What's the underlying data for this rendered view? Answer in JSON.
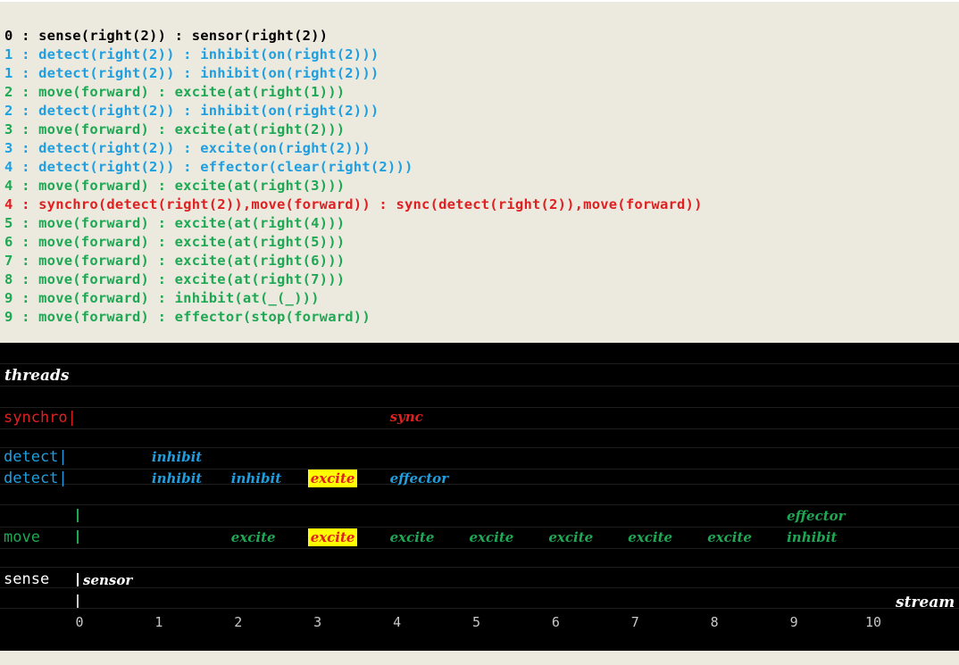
{
  "colors": {
    "log_bg": "#ece9df",
    "panel_bg": "#000000",
    "black": "#000000",
    "blue": "#1f9fe0",
    "green": "#1fa854",
    "red": "#e02020",
    "white": "#ffffff",
    "highlight": "#ffff00",
    "axis": "#c8c8c8"
  },
  "log": [
    {
      "text": "0 : sense(right(2)) : sensor(right(2))",
      "color": "black"
    },
    {
      "text": "1 : detect(right(2)) : inhibit(on(right(2)))",
      "color": "blue"
    },
    {
      "text": "1 : detect(right(2)) : inhibit(on(right(2)))",
      "color": "blue"
    },
    {
      "text": "2 : move(forward) : excite(at(right(1)))",
      "color": "green"
    },
    {
      "text": "2 : detect(right(2)) : inhibit(on(right(2)))",
      "color": "blue"
    },
    {
      "text": "3 : move(forward) : excite(at(right(2)))",
      "color": "green"
    },
    {
      "text": "3 : detect(right(2)) : excite(on(right(2)))",
      "color": "blue"
    },
    {
      "text": "4 : detect(right(2)) : effector(clear(right(2)))",
      "color": "blue"
    },
    {
      "text": "4 : move(forward) : excite(at(right(3)))",
      "color": "green"
    },
    {
      "text": "4 : synchro(detect(right(2)),move(forward)) : sync(detect(right(2)),move(forward))",
      "color": "red"
    },
    {
      "text": "5 : move(forward) : excite(at(right(4)))",
      "color": "green"
    },
    {
      "text": "6 : move(forward) : excite(at(right(5)))",
      "color": "green"
    },
    {
      "text": "7 : move(forward) : excite(at(right(6)))",
      "color": "green"
    },
    {
      "text": "8 : move(forward) : excite(at(right(7)))",
      "color": "green"
    },
    {
      "text": "9 : move(forward) : inhibit(at(_(_)))",
      "color": "green"
    },
    {
      "text": "9 : move(forward) : effector(stop(forward))",
      "color": "green"
    }
  ],
  "panel": {
    "title": "threads",
    "stream_label": "stream",
    "threads": [
      {
        "label": "synchro|",
        "color": "red",
        "row": "synchro"
      },
      {
        "label": "detect|",
        "color": "blue",
        "row": "detect1"
      },
      {
        "label": "detect|",
        "color": "blue",
        "row": "detect2"
      },
      {
        "label": "move",
        "color": "green",
        "row": "move"
      },
      {
        "label": "sense",
        "color": "white",
        "row": "sense"
      }
    ],
    "events": [
      {
        "row": "synchro",
        "t": 4,
        "text": "sync",
        "color": "red",
        "highlight": false
      },
      {
        "row": "detect1",
        "t": 1,
        "text": "inhibit",
        "color": "blue",
        "highlight": false
      },
      {
        "row": "detect2",
        "t": 1,
        "text": "inhibit",
        "color": "blue",
        "highlight": false
      },
      {
        "row": "detect2",
        "t": 2,
        "text": "inhibit",
        "color": "blue",
        "highlight": false
      },
      {
        "row": "detect2",
        "t": 3,
        "text": "excite",
        "color": "red",
        "highlight": true
      },
      {
        "row": "detect2",
        "t": 4,
        "text": "effector",
        "color": "blue",
        "highlight": false
      },
      {
        "row": "move_top",
        "t": 9,
        "text": "effector",
        "color": "green",
        "highlight": false
      },
      {
        "row": "move",
        "t": 2,
        "text": "excite",
        "color": "green",
        "highlight": false
      },
      {
        "row": "move",
        "t": 3,
        "text": "excite",
        "color": "red",
        "highlight": true
      },
      {
        "row": "move",
        "t": 4,
        "text": "excite",
        "color": "green",
        "highlight": false
      },
      {
        "row": "move",
        "t": 5,
        "text": "excite",
        "color": "green",
        "highlight": false
      },
      {
        "row": "move",
        "t": 6,
        "text": "excite",
        "color": "green",
        "highlight": false
      },
      {
        "row": "move",
        "t": 7,
        "text": "excite",
        "color": "green",
        "highlight": false
      },
      {
        "row": "move",
        "t": 8,
        "text": "excite",
        "color": "green",
        "highlight": false
      },
      {
        "row": "move",
        "t": 9,
        "text": "inhibit",
        "color": "green",
        "highlight": false
      },
      {
        "row": "sense",
        "t": 0,
        "text": "sensor",
        "color": "white",
        "highlight": false
      }
    ],
    "axis_ticks": [
      "0",
      "1",
      "2",
      "3",
      "4",
      "5",
      "6",
      "7",
      "8",
      "9",
      "10"
    ]
  }
}
